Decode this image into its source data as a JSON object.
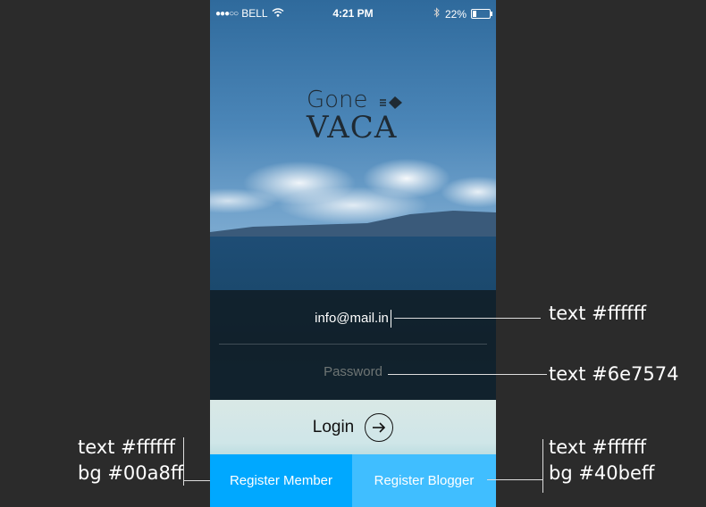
{
  "status_bar": {
    "signal_dots": "●●●○○",
    "carrier": "BELL",
    "time": "4:21 PM",
    "battery_percent": "22%",
    "battery_level": 0.22
  },
  "logo": {
    "line1": "Gone",
    "line2": "VACA"
  },
  "form": {
    "email_value": "info@mail.in",
    "password_placeholder": "Password"
  },
  "login": {
    "label": "Login",
    "arrow_glyph": "→"
  },
  "buttons": {
    "register_member": "Register Member",
    "register_blogger": "Register Blogger"
  },
  "annotations": {
    "email_text": "text #ffffff",
    "password_text": "text #6e7574",
    "member_text": "text #ffffff",
    "member_bg": "bg #00a8ff",
    "blogger_text": "text #ffffff",
    "blogger_bg": "bg #40beff"
  },
  "colors": {
    "page_bg": "#2b2b2b",
    "email_text": "#ffffff",
    "password_text": "#6e7574",
    "member_bg": "#00a8ff",
    "blogger_bg": "#40beff"
  }
}
